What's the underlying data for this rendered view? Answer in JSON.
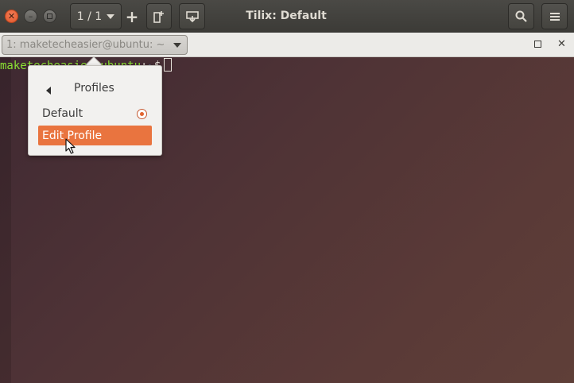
{
  "header": {
    "title": "Tilix: Default",
    "session_label": "1 / 1",
    "add_label": "+"
  },
  "terminal": {
    "title": "1: maketecheasier@ubuntu: ~",
    "prompt_user": "maketecheasier@ubuntu",
    "prompt_sep": ":",
    "prompt_path": "~",
    "prompt_symbol": "$"
  },
  "popover": {
    "header": "Profiles",
    "items": [
      {
        "label": "Default",
        "selected": true
      },
      {
        "label": "Edit Profile",
        "highlighted": true
      }
    ]
  },
  "icons": {
    "close": "close-icon",
    "minimize": "minimize-icon",
    "maximize": "maximize-icon",
    "split": "add-terminal-icon",
    "sync": "sync-input-icon",
    "search": "search-icon",
    "menu": "hamburger-menu-icon"
  },
  "colors": {
    "accent": "#e9743f",
    "close_button": "#e35a2e",
    "prompt_green": "#8ae234",
    "prompt_blue": "#729fcf"
  }
}
